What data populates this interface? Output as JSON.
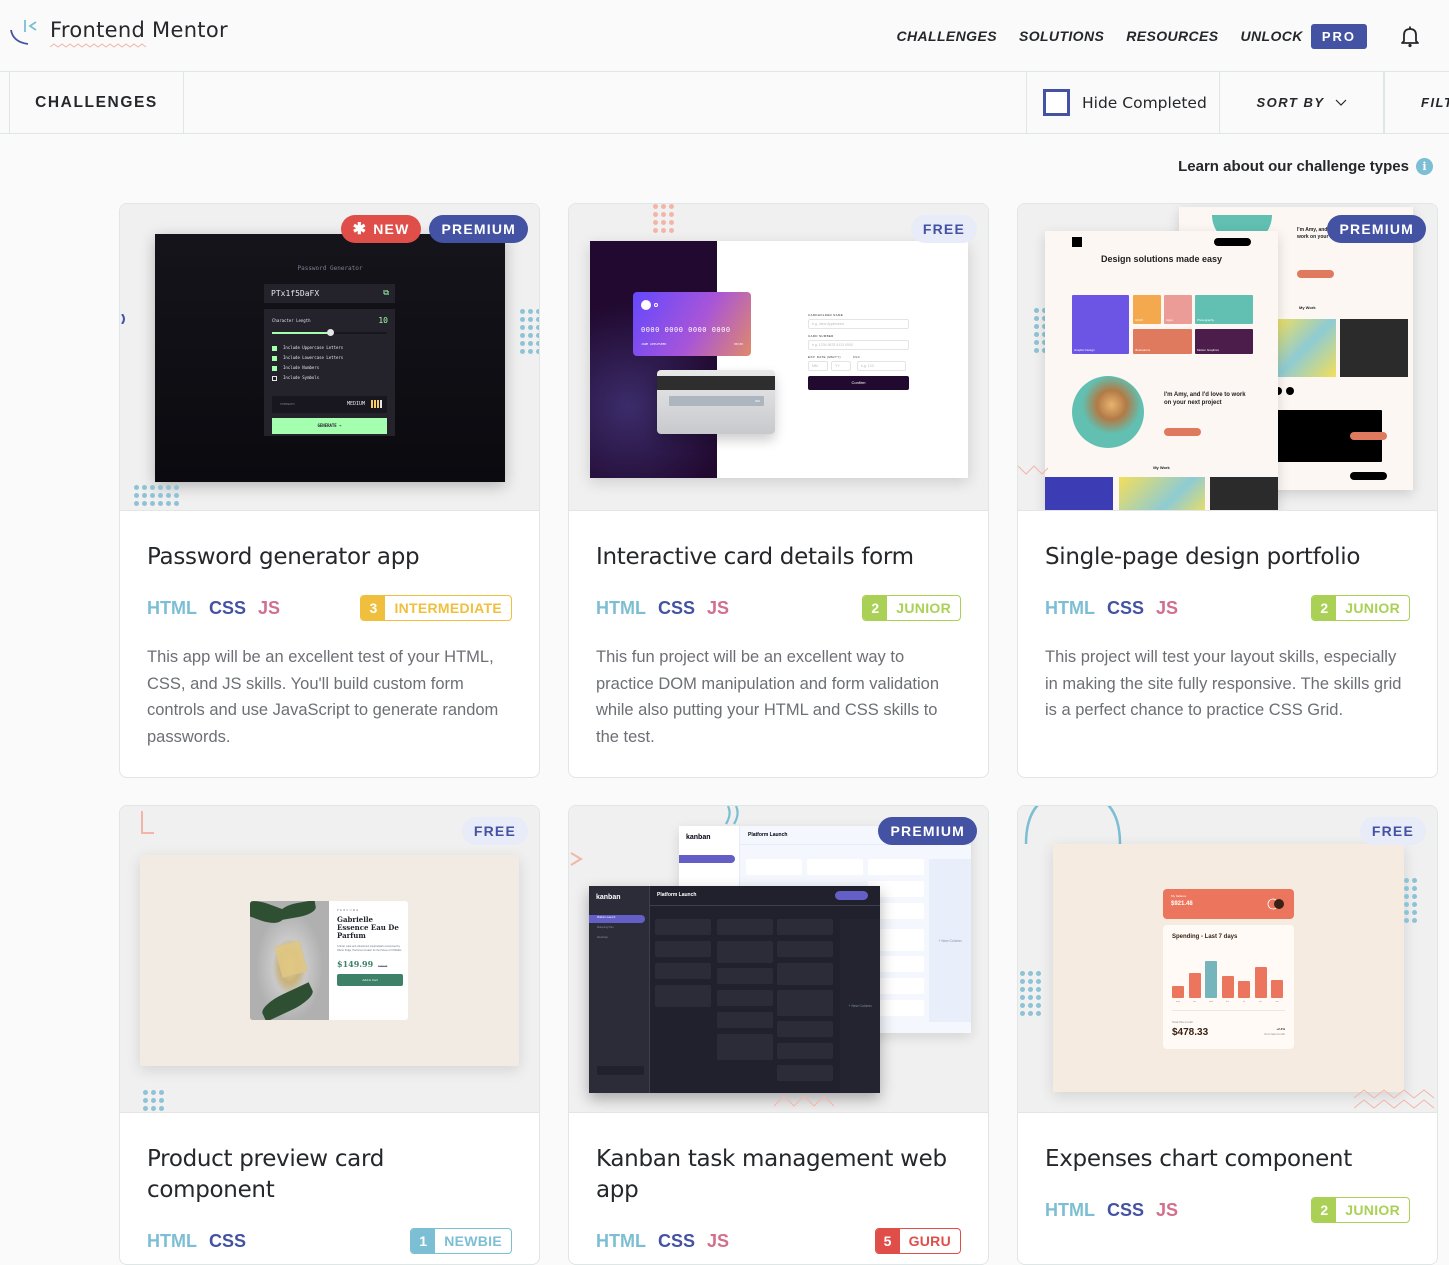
{
  "header": {
    "logo_text": "Frontend Mentor",
    "nav": [
      {
        "label": "CHALLENGES"
      },
      {
        "label": "SOLUTIONS"
      },
      {
        "label": "RESOURCES"
      },
      {
        "label": "UNLOCK"
      }
    ],
    "pro_label": "PRO",
    "notifications_icon": "bell-icon"
  },
  "subbar": {
    "title": "CHALLENGES",
    "hide_completed_label": "Hide Completed",
    "hide_completed_checked": false,
    "sort_label": "SORT BY",
    "filter_label": "FILT"
  },
  "learn_link": {
    "label": "Learn about our challenge types",
    "icon": "info-icon"
  },
  "colors": {
    "brand_blue": "#4452a3",
    "html": "#7cbed3",
    "css": "#4452a3",
    "js": "#d16f8d",
    "newbie": "#7cbed3",
    "junior": "#aad155",
    "intermediate": "#f0bf3d",
    "guru": "#e04e4a",
    "new_badge": "#e04e4a"
  },
  "cards": [
    {
      "title": "Password generator app",
      "badges": [
        "NEW",
        "PREMIUM"
      ],
      "languages": [
        "HTML",
        "CSS",
        "JS"
      ],
      "level_num": "3",
      "level_name": "INTERMEDIATE",
      "description": "This app will be an excellent test of your HTML, CSS, and JS skills. You'll build custom form controls and use JavaScript to generate random passwords.",
      "preview": {
        "heading": "Password Generator",
        "password": "PTx1f5DaFX",
        "length_label": "Character Length",
        "length_value": "10",
        "length_fraction": 0.5,
        "options": [
          {
            "label": "Include Uppercase Letters",
            "checked": true
          },
          {
            "label": "Include Lowercase Letters",
            "checked": true
          },
          {
            "label": "Include Numbers",
            "checked": true
          },
          {
            "label": "Include Symbols",
            "checked": false
          }
        ],
        "strength_label": "STRENGTH",
        "strength_value": "MEDIUM",
        "strength_bars_filled": 3,
        "strength_bars_total": 4,
        "generate_label": "GENERATE →"
      }
    },
    {
      "title": "Interactive card details form",
      "badges": [
        "FREE"
      ],
      "languages": [
        "HTML",
        "CSS",
        "JS"
      ],
      "level_num": "2",
      "level_name": "JUNIOR",
      "description": "This fun project will be an excellent way to practice DOM manipulation and form validation while also putting your HTML and CSS skills to the test.",
      "preview": {
        "card_number": "0000 0000 0000 0000",
        "card_name": "JANE APPLESEED",
        "card_exp": "00/00",
        "card_cvc": "000",
        "fields": [
          {
            "label": "CARDHOLDER NAME",
            "placeholder": "e.g. Jane Appleseed"
          },
          {
            "label": "CARD NUMBER",
            "placeholder": "e.g. 1234 5678 9123 0000"
          }
        ],
        "exp_label": "EXP. DATE (MM/YY)",
        "cvc_label": "CVC",
        "mm_placeholder": "MM",
        "yy_placeholder": "YY",
        "cvc_placeholder": "e.g. 123",
        "confirm_label": "Confirm"
      }
    },
    {
      "title": "Single-page design portfolio",
      "badges": [
        "PREMIUM"
      ],
      "languages": [
        "HTML",
        "CSS",
        "JS"
      ],
      "level_num": "2",
      "level_name": "JUNIOR",
      "description": "This project will test your layout skills, especially in making the site fully responsive. The skills grid is a perfect chance to practice CSS Grid.",
      "preview": {
        "heading": "Design solutions made easy",
        "tiles": [
          "Graphic Design",
          "UI/UX",
          "Apps",
          "Photography",
          "Illustrations",
          "Motion Graphics"
        ],
        "amy_text": "I'm Amy, and I'd love to work on your next project",
        "my_work": "My Work"
      }
    },
    {
      "title": "Product preview card component",
      "badges": [
        "FREE"
      ],
      "languages": [
        "HTML",
        "CSS"
      ],
      "level_num": "1",
      "level_name": "NEWBIE",
      "description": "",
      "preview": {
        "category": "PERFUME",
        "product_name": "Gabrielle Essence Eau De Parfum",
        "product_desc": "A floral, solar and voluptuous interpretation composed by Olivier Polge, Perfumer-Creator for the House of CHANEL.",
        "price": "$149.99",
        "old_price": "$169.99",
        "cart_label": "Add to Cart"
      }
    },
    {
      "title": "Kanban task management web app",
      "badges": [
        "PREMIUM"
      ],
      "languages": [
        "HTML",
        "CSS",
        "JS"
      ],
      "level_num": "5",
      "level_name": "GURU",
      "description": "",
      "preview": {
        "logo": "kanban",
        "board_title": "Platform Launch",
        "boards": [
          "Platform Launch",
          "Marketing Plan",
          "Roadmap"
        ],
        "new_column": "+ New Column",
        "add_task": "+ Add New Task"
      }
    },
    {
      "title": "Expenses chart component",
      "badges": [
        "FREE"
      ],
      "languages": [
        "HTML",
        "CSS",
        "JS"
      ],
      "level_num": "2",
      "level_name": "JUNIOR",
      "description": "",
      "preview": {
        "balance_label": "My balance",
        "balance": "$921.48",
        "spending_title": "Spending - Last 7 days",
        "days": [
          "mon",
          "tue",
          "wed",
          "thu",
          "fri",
          "sat",
          "sun"
        ],
        "amounts": [
          17.45,
          34.91,
          52.36,
          31.07,
          23.39,
          43.28,
          25.48
        ],
        "highlight_day": "wed",
        "total_label": "Total this month",
        "total": "$478.33",
        "change": "+2.4%",
        "change_label": "from last month"
      }
    }
  ]
}
